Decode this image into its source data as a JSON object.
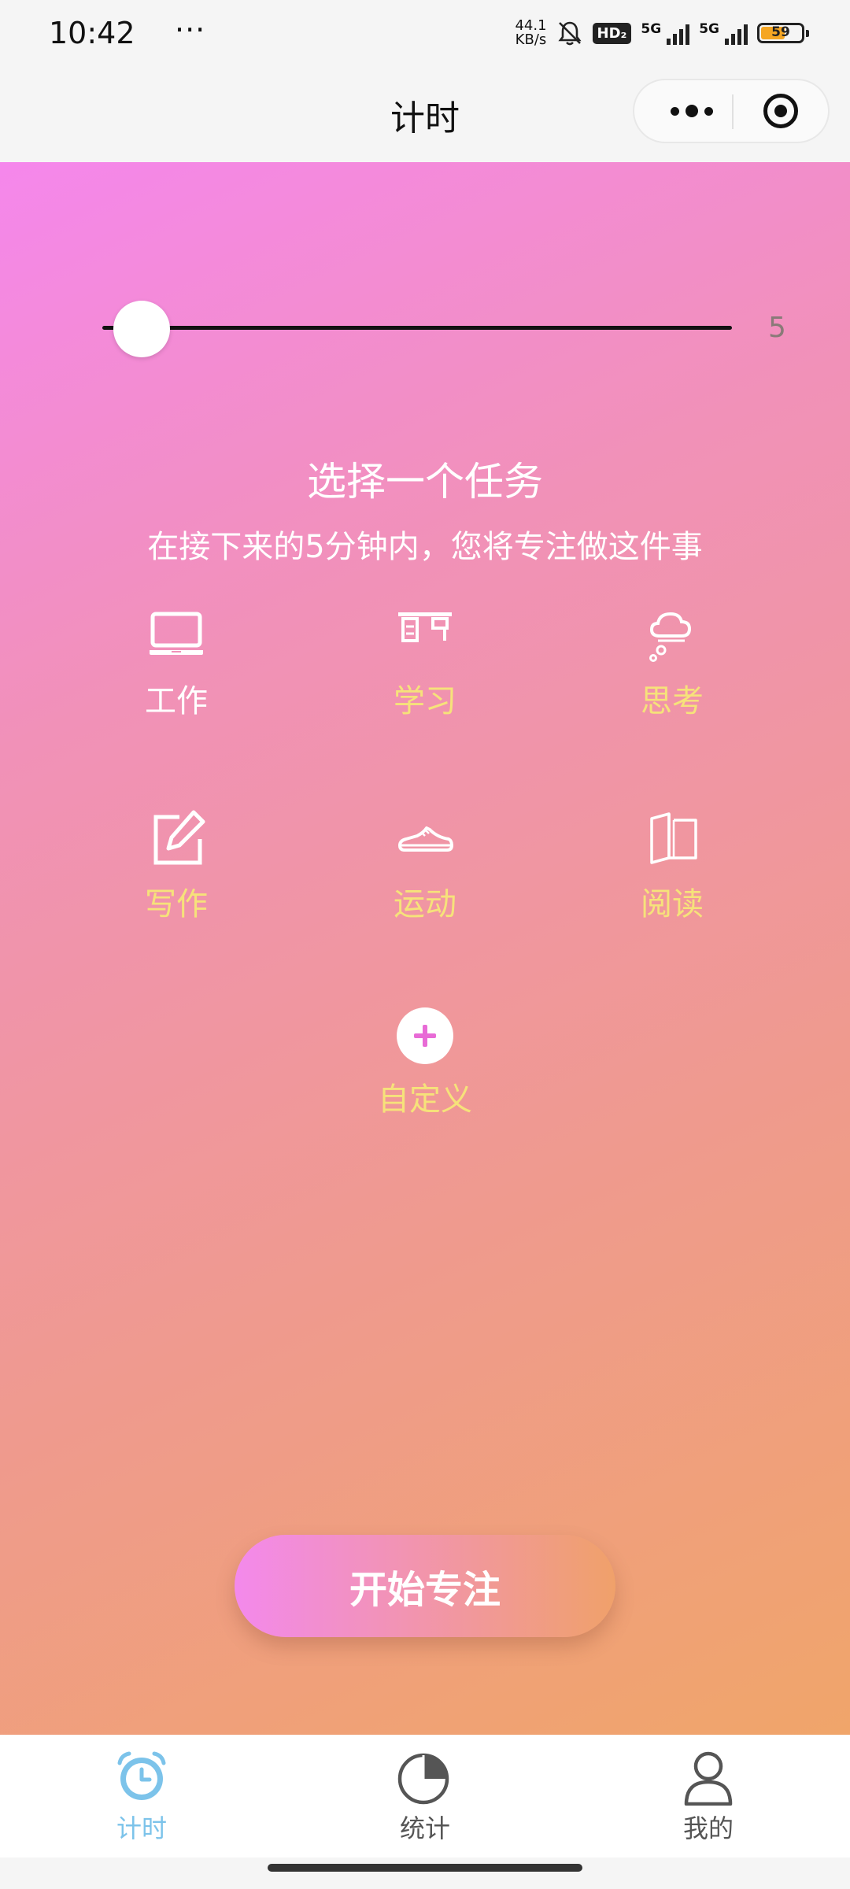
{
  "status_bar": {
    "time": "10:42",
    "left_extra": "···",
    "net_speed_value": "44.1",
    "net_speed_unit": "KB/s",
    "hd_label": "HD₂",
    "sim1_label": "5G",
    "sim2_label": "5G",
    "battery_level": "59",
    "battery_fraction": 0.59
  },
  "nav": {
    "title": "计时"
  },
  "timer": {
    "slider_value": "5",
    "slider_fraction": 0.0,
    "heading": "选择一个任务",
    "subheading": "在接下来的5分钟内，您将专注做这件事"
  },
  "tasks": [
    {
      "label": "工作",
      "icon": "laptop-icon",
      "selected": true
    },
    {
      "label": "学习",
      "icon": "desk-icon",
      "selected": false
    },
    {
      "label": "思考",
      "icon": "thought-cloud-icon",
      "selected": false
    },
    {
      "label": "写作",
      "icon": "edit-icon",
      "selected": false
    },
    {
      "label": "运动",
      "icon": "sneaker-icon",
      "selected": false
    },
    {
      "label": "阅读",
      "icon": "book-icon",
      "selected": false
    }
  ],
  "custom_task": {
    "label": "自定义",
    "icon": "plus-icon"
  },
  "start_button": {
    "label": "开始专注"
  },
  "tab_bar": [
    {
      "label": "计时",
      "icon": "alarm-clock-icon",
      "active": true
    },
    {
      "label": "统计",
      "icon": "pie-chart-icon",
      "active": false
    },
    {
      "label": "我的",
      "icon": "user-icon",
      "active": false
    }
  ],
  "colors": {
    "gradient_start": "#f587ec",
    "gradient_end": "#f0a56a",
    "label_selected": "#ffffff",
    "label_unselected": "#f6e27a",
    "tab_active": "#7cc3ea",
    "tab_inactive": "#555555",
    "plus_accent": "#e86bd6"
  }
}
